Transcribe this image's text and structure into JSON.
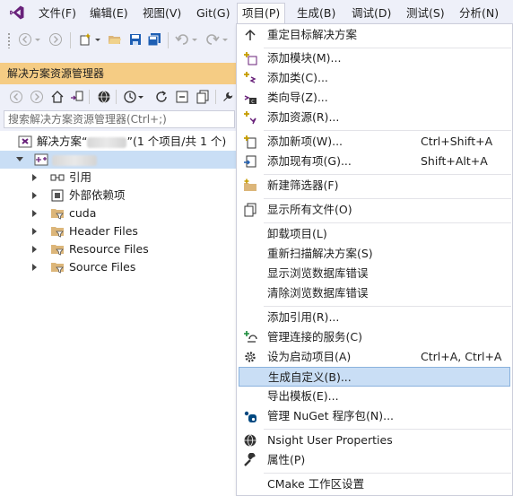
{
  "menubar": {
    "items": [
      "文件(F)",
      "编辑(E)",
      "视图(V)",
      "Git(G)",
      "项目(P)",
      "生成(B)",
      "调试(D)",
      "测试(S)",
      "分析(N)"
    ],
    "active_index": 4
  },
  "solution_explorer": {
    "title": "解决方案资源管理器",
    "search_placeholder": "搜索解决方案资源管理器(Ctrl+;)",
    "solution_row": {
      "prefix": "解决方案“",
      "suffix": "”(1 个项目/共 1 个)"
    },
    "children": [
      {
        "label": "引用",
        "icon": "references-icon"
      },
      {
        "label": "外部依赖项",
        "icon": "external-dependencies-icon"
      },
      {
        "label": "cuda",
        "icon": "filter-folder-icon"
      },
      {
        "label": "Header Files",
        "icon": "filter-folder-icon"
      },
      {
        "label": "Resource Files",
        "icon": "filter-folder-icon"
      },
      {
        "label": "Source Files",
        "icon": "filter-folder-icon"
      }
    ]
  },
  "project_menu": {
    "items": [
      {
        "label": "重定目标解决方案",
        "shortcut": "",
        "icon": "retarget-arrow-icon"
      },
      {
        "label": "添加模块(M)...",
        "shortcut": "",
        "icon": "add-module-icon"
      },
      {
        "label": "添加类(C)...",
        "shortcut": "",
        "icon": "add-class-icon"
      },
      {
        "label": "类向导(Z)...",
        "shortcut": "",
        "icon": "class-wizard-icon"
      },
      {
        "label": "添加资源(R)...",
        "shortcut": "",
        "icon": "add-resource-icon"
      },
      {
        "label": "添加新项(W)...",
        "shortcut": "Ctrl+Shift+A",
        "icon": "add-new-item-icon"
      },
      {
        "label": "添加现有项(G)...",
        "shortcut": "Shift+Alt+A",
        "icon": "add-existing-item-icon"
      },
      {
        "label": "新建筛选器(F)",
        "shortcut": "",
        "icon": "new-filter-icon"
      },
      {
        "label": "显示所有文件(O)",
        "shortcut": "",
        "icon": "show-all-files-icon"
      },
      {
        "label": "卸载项目(L)",
        "shortcut": "",
        "icon": ""
      },
      {
        "label": "重新扫描解决方案(S)",
        "shortcut": "",
        "icon": ""
      },
      {
        "label": "显示浏览数据库错误",
        "shortcut": "",
        "icon": ""
      },
      {
        "label": "清除浏览数据库错误",
        "shortcut": "",
        "icon": ""
      },
      {
        "label": "添加引用(R)...",
        "shortcut": "",
        "icon": ""
      },
      {
        "label": "管理连接的服务(C)",
        "shortcut": "",
        "icon": "connected-services-icon"
      },
      {
        "label": "设为启动项目(A)",
        "shortcut": "Ctrl+A, Ctrl+A",
        "icon": "gear-icon"
      },
      {
        "label": "生成自定义(B)...",
        "shortcut": "",
        "icon": ""
      },
      {
        "label": "导出模板(E)...",
        "shortcut": "",
        "icon": ""
      },
      {
        "label": "管理 NuGet 程序包(N)...",
        "shortcut": "",
        "icon": "nuget-icon"
      },
      {
        "label": "Nsight User Properties",
        "shortcut": "",
        "icon": "nsight-icon"
      },
      {
        "label": "属性(P)",
        "shortcut": "",
        "icon": "wrench-icon"
      },
      {
        "label": "CMake 工作区设置",
        "shortcut": "",
        "icon": ""
      }
    ],
    "highlighted_index": 16
  },
  "colors": {
    "accent": "#f5cc84",
    "selection": "#c9def5",
    "highlight_border": "#8ab2dd",
    "vs_purple": "#68217a"
  }
}
